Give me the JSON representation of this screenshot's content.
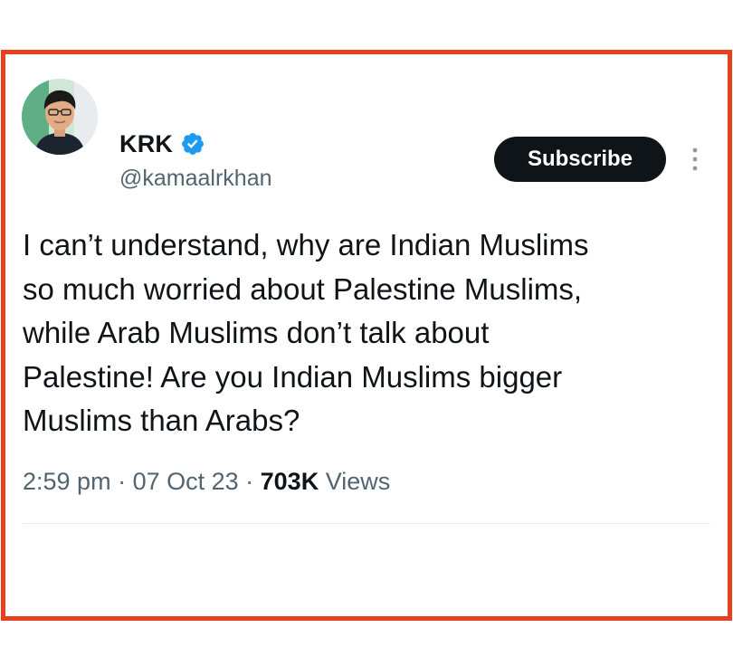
{
  "tweet": {
    "author": {
      "display_name": "KRK",
      "handle": "@kamaalrkhan",
      "verified": true
    },
    "subscribe_label": "Subscribe",
    "text": "I can’t understand, why are Indian Muslims\nso much worried about Palestine Muslims,\nwhile Arab Muslims don’t talk about\nPalestine! Are you Indian Muslims bigger\nMuslims than Arabs?",
    "meta": {
      "time": "2:59 pm",
      "separator": " · ",
      "date": "07 Oct 23",
      "views_count": "703K",
      "views_label": " Views"
    }
  },
  "colors": {
    "frame_border": "#e8401f",
    "verified_badge": "#1d9bf0",
    "secondary_text": "#536471",
    "primary_text": "#0f1419"
  },
  "icons": {
    "verified": "verified-badge-icon",
    "more": "more-vertical-icon"
  }
}
